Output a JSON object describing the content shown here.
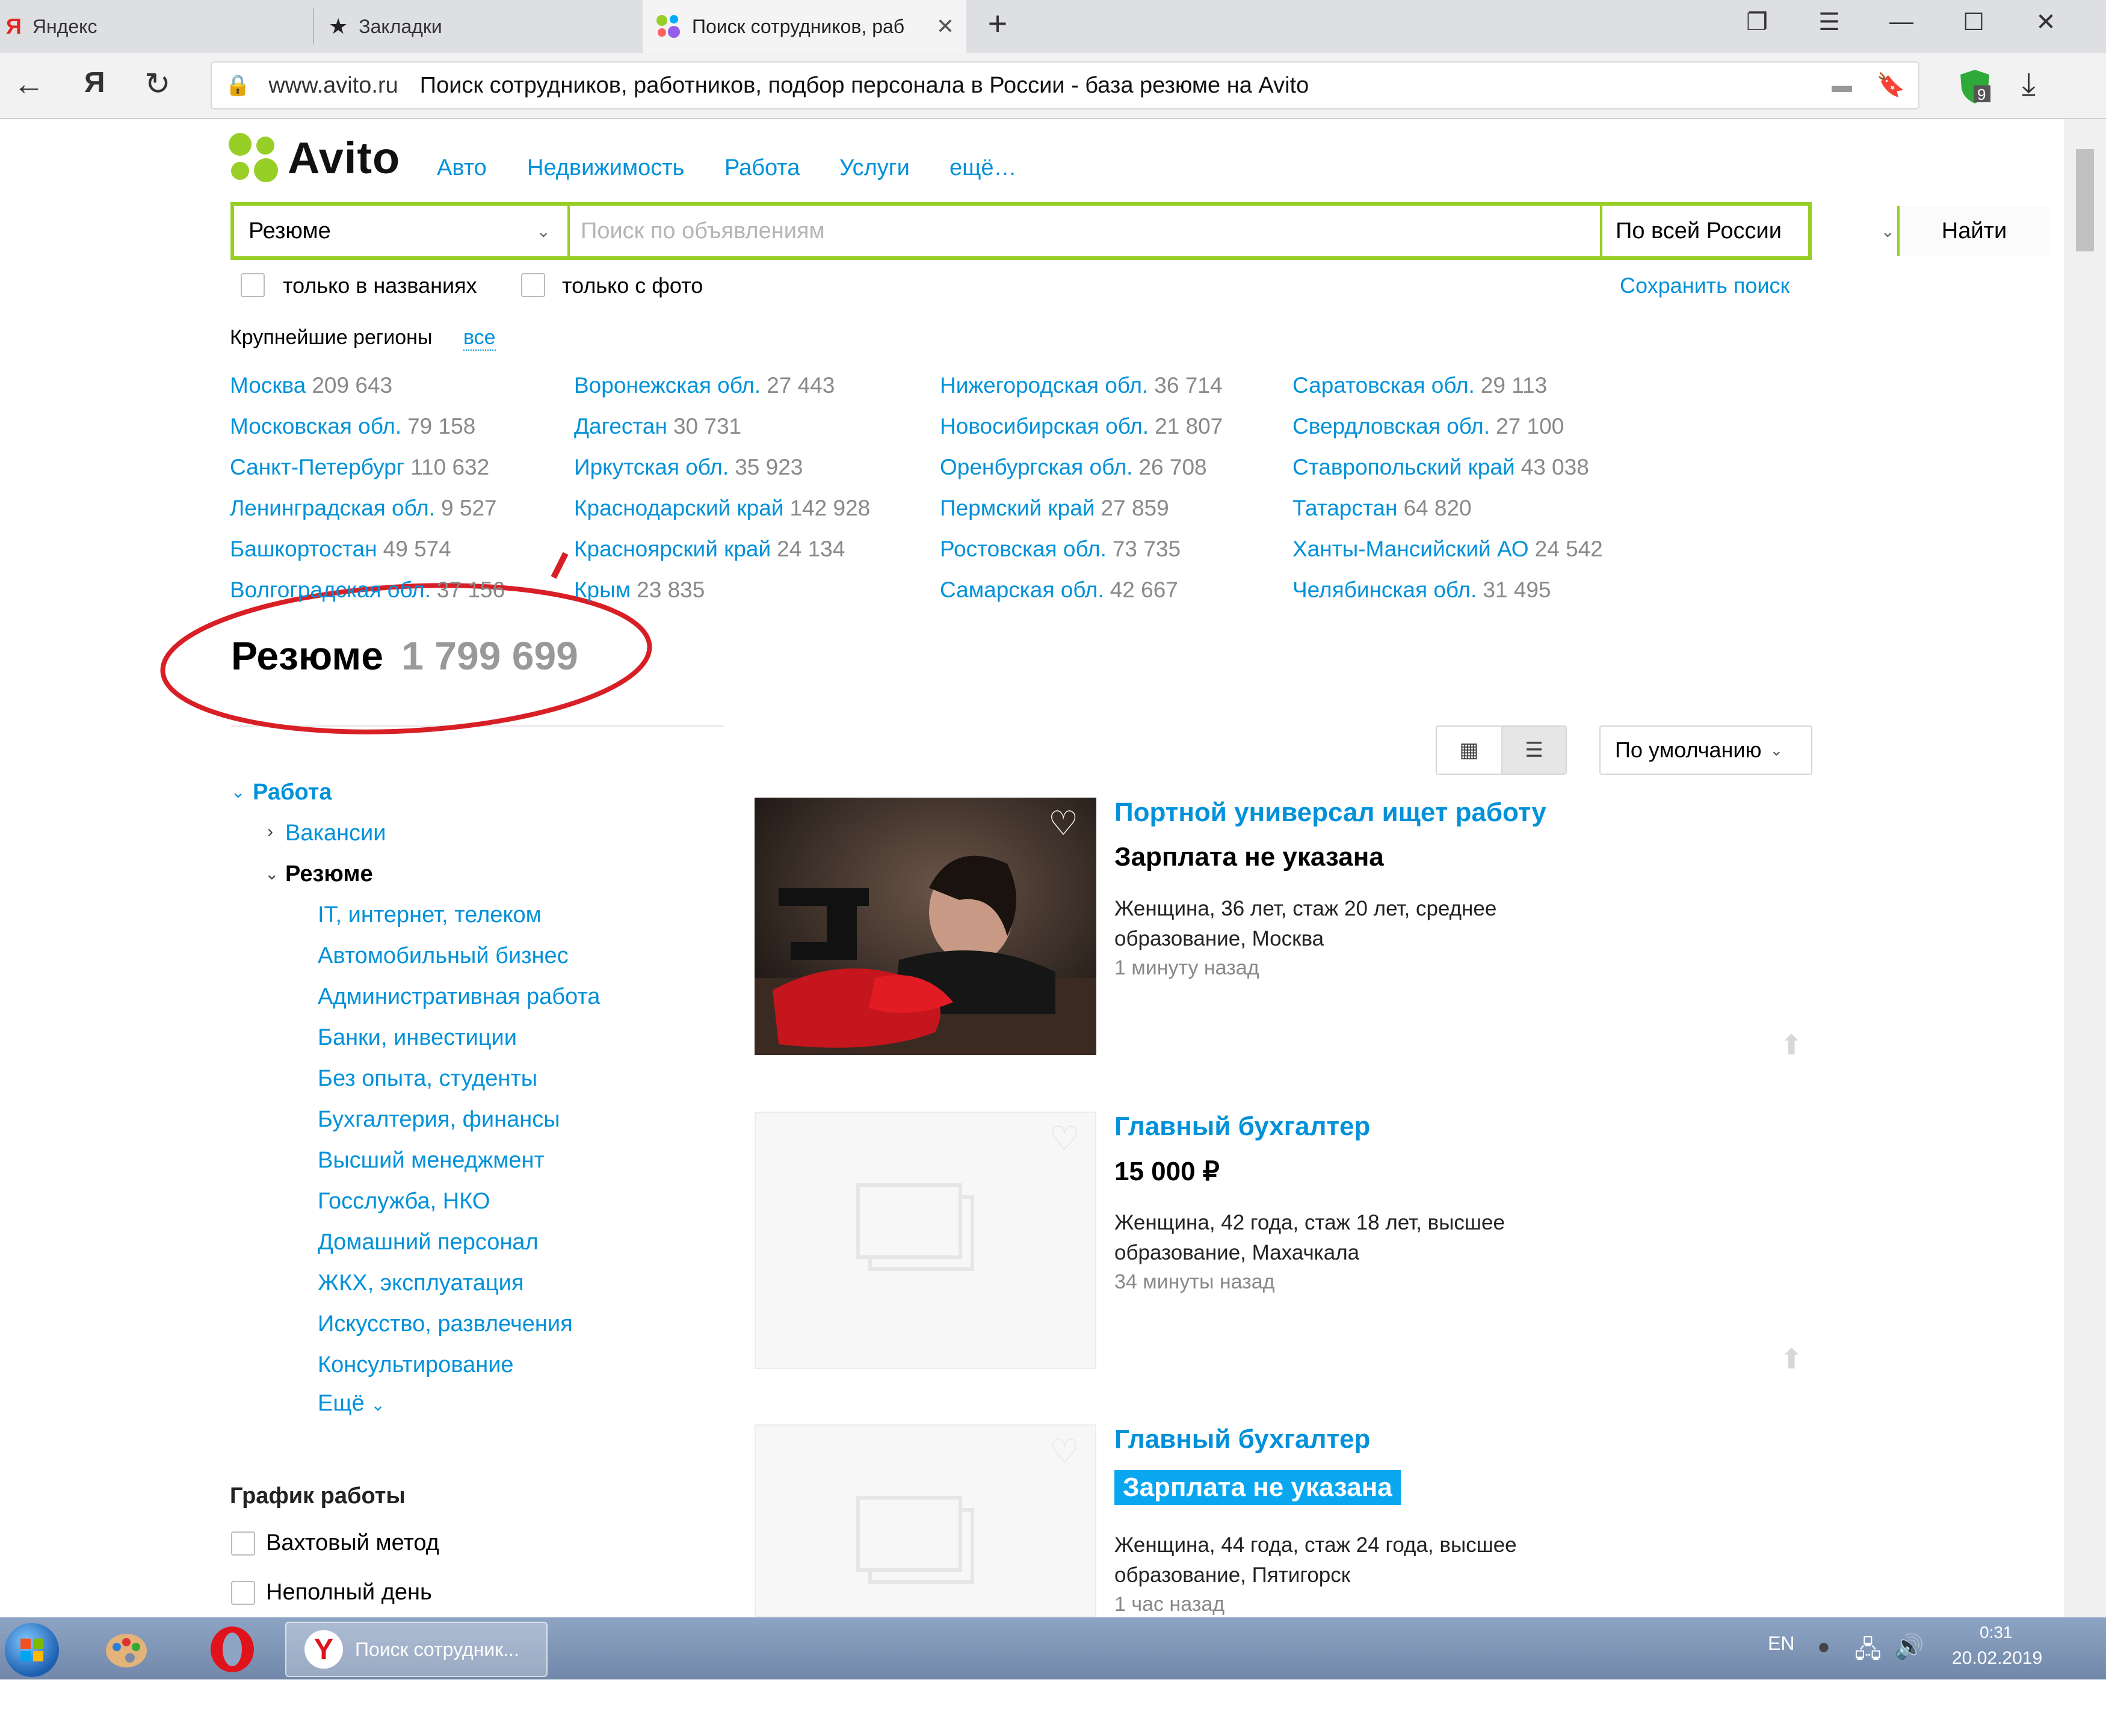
{
  "browser": {
    "tabs": [
      {
        "label": "Яндекс",
        "icon": "yandex-icon"
      },
      {
        "label": "Закладки",
        "icon": "star-icon"
      },
      {
        "label": "Поиск сотрудников, раб",
        "icon": "avito-icon"
      }
    ],
    "url_domain": "www.avito.ru",
    "page_title": "Поиск сотрудников, работников, подбор персонала в России - база резюме на Avito",
    "ext_badge": "9"
  },
  "header": {
    "logo": "Avito",
    "nav": [
      "Авто",
      "Недвижимость",
      "Работа",
      "Услуги",
      "ещё…"
    ]
  },
  "search": {
    "category": "Резюме",
    "placeholder": "Поиск по объявлениям",
    "location": "По всей России",
    "submit": "Найти",
    "only_titles": "только в названиях",
    "only_photo": "только с фото",
    "save": "Сохранить поиск"
  },
  "regions": {
    "heading": "Крупнейшие регионы",
    "all": "все",
    "columns": [
      [
        {
          "name": "Москва",
          "count": "209 643"
        },
        {
          "name": "Московская обл.",
          "count": "79 158"
        },
        {
          "name": "Санкт-Петербург",
          "count": "110 632"
        },
        {
          "name": "Ленинградская обл.",
          "count": "9 527"
        },
        {
          "name": "Башкортостан",
          "count": "49 574"
        },
        {
          "name": "Волгоградская обл.",
          "count": "37 156"
        }
      ],
      [
        {
          "name": "Воронежская обл.",
          "count": "27 443"
        },
        {
          "name": "Дагестан",
          "count": "30 731"
        },
        {
          "name": "Иркутская обл.",
          "count": "35 923"
        },
        {
          "name": "Краснодарский край",
          "count": "142 928"
        },
        {
          "name": "Красноярский край",
          "count": "24 134"
        },
        {
          "name": "Крым",
          "count": "23 835"
        }
      ],
      [
        {
          "name": "Нижегородская обл.",
          "count": "36 714"
        },
        {
          "name": "Новосибирская обл.",
          "count": "21 807"
        },
        {
          "name": "Оренбургская обл.",
          "count": "26 708"
        },
        {
          "name": "Пермский край",
          "count": "27 859"
        },
        {
          "name": "Ростовская обл.",
          "count": "73 735"
        },
        {
          "name": "Самарская обл.",
          "count": "42 667"
        }
      ],
      [
        {
          "name": "Саратовская обл.",
          "count": "29 113"
        },
        {
          "name": "Свердловская обл.",
          "count": "27 100"
        },
        {
          "name": "Ставропольский край",
          "count": "43 038"
        },
        {
          "name": "Татарстан",
          "count": "64 820"
        },
        {
          "name": "Ханты-Мансийский АО",
          "count": "24 542"
        },
        {
          "name": "Челябинская обл.",
          "count": "31 495"
        }
      ]
    ]
  },
  "results": {
    "title": "Резюме",
    "count": "1 799 699",
    "sort": "По умолчанию"
  },
  "sidebar": {
    "root": "Работа",
    "vacancies": "Вакансии",
    "resume": "Резюме",
    "categories": [
      "IT, интернет, телеком",
      "Автомобильный бизнес",
      "Административная работа",
      "Банки, инвестиции",
      "Без опыта, студенты",
      "Бухгалтерия, финансы",
      "Высший менеджмент",
      "Госслужба, НКО",
      "Домашний персонал",
      "ЖКХ, эксплуатация",
      "Искусство, развлечения",
      "Консультирование"
    ],
    "more": "Ещё",
    "schedule_title": "График работы",
    "schedule": [
      "Вахтовый метод",
      "Неполный день"
    ]
  },
  "listings": [
    {
      "title": "Портной универсал ищет работу",
      "price": "Зарплата не указана",
      "desc": "Женщина, 36 лет, стаж 20 лет, среднее образование, Москва",
      "ago": "1 минуту назад"
    },
    {
      "title": "Главный бухгалтер",
      "price": "15 000 ₽",
      "desc": "Женщина, 42 года, стаж 18 лет, высшее образование, Махачкала",
      "ago": "34 минуты назад"
    },
    {
      "title": "Главный бухгалтер",
      "price": "Зарплата не указана",
      "desc": "Женщина, 44 года, стаж 24 года, высшее образование, Пятигорск",
      "ago": "1 час назад"
    }
  ],
  "taskbar": {
    "task_label": "Поиск сотрудник...",
    "lang": "EN",
    "time": "0:31",
    "date": "20.02.2019"
  },
  "colors": {
    "link": "#0091d9",
    "brand_green": "#97cf26",
    "annotation": "#d81f26",
    "highlight": "#0aa7f0"
  }
}
